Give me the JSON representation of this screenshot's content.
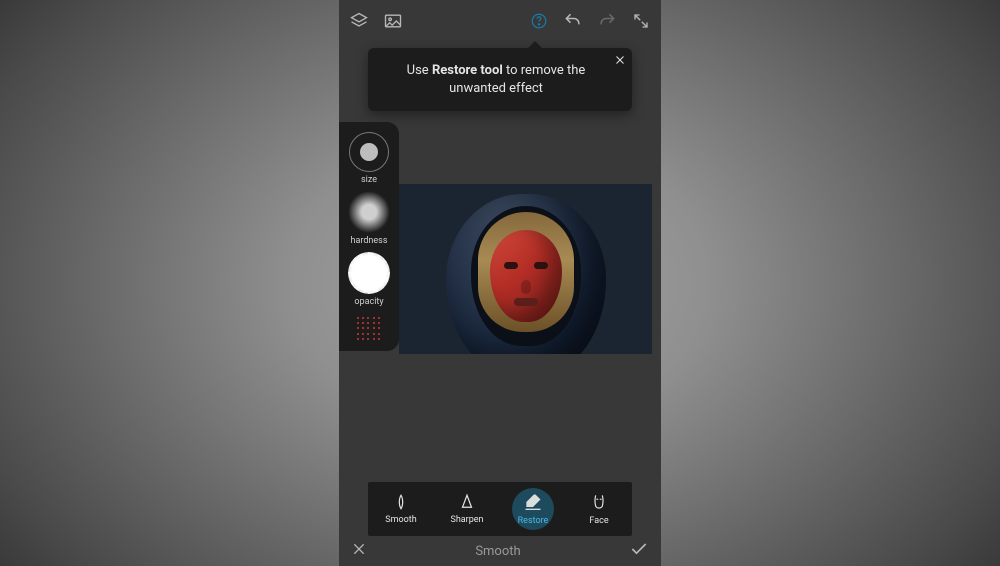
{
  "tooltip": {
    "prefix": "Use ",
    "bold": "Restore tool",
    "suffix": " to remove the unwanted effect"
  },
  "brush": {
    "size_label": "size",
    "hardness_label": "hardness",
    "opacity_label": "opacity"
  },
  "tools": {
    "smooth": "Smooth",
    "sharpen": "Sharpen",
    "restore": "Restore",
    "face": "Face",
    "selected": "restore"
  },
  "bottom": {
    "title": "Smooth"
  },
  "colors": {
    "accent": "#4fb7e6",
    "accent_bg": "#1d4a5d"
  }
}
